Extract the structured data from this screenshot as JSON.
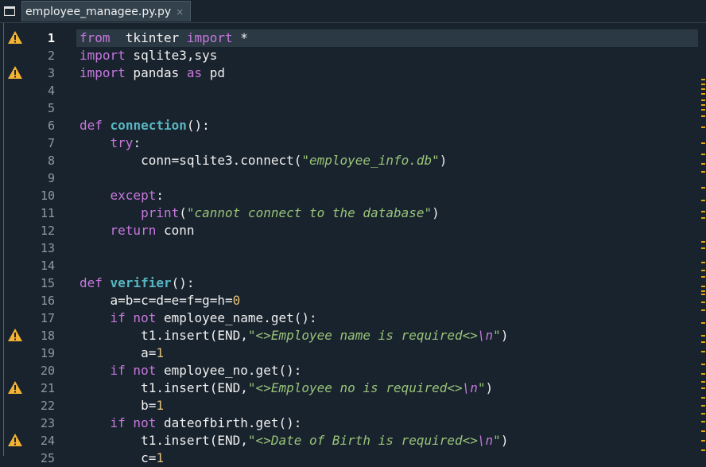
{
  "tab": {
    "label": "employee_managee.py.py",
    "close": "×"
  },
  "icons": {
    "tab_menu": "window-icon",
    "warning": "warning-icon"
  },
  "colors": {
    "warning": "#f2b233",
    "accent": "#1a72bb"
  },
  "current_line": 1,
  "lines": [
    {
      "n": "1",
      "warn": true,
      "tokens": [
        [
          "kw",
          "from"
        ],
        [
          "",
          "  tkinter "
        ],
        [
          "kw",
          "import"
        ],
        [
          "",
          " *"
        ]
      ]
    },
    {
      "n": "2",
      "warn": false,
      "tokens": [
        [
          "kw",
          "import"
        ],
        [
          "",
          " sqlite3,sys"
        ]
      ]
    },
    {
      "n": "3",
      "warn": true,
      "tokens": [
        [
          "kw",
          "import"
        ],
        [
          "",
          " pandas "
        ],
        [
          "kw",
          "as"
        ],
        [
          "",
          " pd"
        ]
      ]
    },
    {
      "n": "4",
      "warn": false,
      "tokens": []
    },
    {
      "n": "5",
      "warn": false,
      "tokens": []
    },
    {
      "n": "6",
      "warn": false,
      "tokens": [
        [
          "kw",
          "def"
        ],
        [
          "",
          " "
        ],
        [
          "fn",
          "connection"
        ],
        [
          "",
          "():"
        ]
      ]
    },
    {
      "n": "7",
      "warn": false,
      "tokens": [
        [
          "",
          "    "
        ],
        [
          "kw",
          "try"
        ],
        [
          "",
          ":"
        ]
      ]
    },
    {
      "n": "8",
      "warn": false,
      "tokens": [
        [
          "",
          "        conn=sqlite3.connect("
        ],
        [
          "str",
          "\"employee_info.db\""
        ],
        [
          "",
          ")"
        ]
      ]
    },
    {
      "n": "9",
      "warn": false,
      "tokens": []
    },
    {
      "n": "10",
      "warn": false,
      "tokens": [
        [
          "",
          "    "
        ],
        [
          "kw",
          "except"
        ],
        [
          "",
          ":"
        ]
      ]
    },
    {
      "n": "11",
      "warn": false,
      "tokens": [
        [
          "",
          "        "
        ],
        [
          "bi",
          "print"
        ],
        [
          "",
          "("
        ],
        [
          "str",
          "\"cannot connect to the database\""
        ],
        [
          "",
          ")"
        ]
      ]
    },
    {
      "n": "12",
      "warn": false,
      "tokens": [
        [
          "",
          "    "
        ],
        [
          "kw",
          "return"
        ],
        [
          "",
          " conn"
        ]
      ]
    },
    {
      "n": "13",
      "warn": false,
      "tokens": []
    },
    {
      "n": "14",
      "warn": false,
      "tokens": []
    },
    {
      "n": "15",
      "warn": false,
      "tokens": [
        [
          "kw",
          "def"
        ],
        [
          "",
          " "
        ],
        [
          "fn",
          "verifier"
        ],
        [
          "",
          "():"
        ]
      ]
    },
    {
      "n": "16",
      "warn": false,
      "tokens": [
        [
          "",
          "    a=b=c=d=e=f=g=h="
        ],
        [
          "num",
          "0"
        ]
      ]
    },
    {
      "n": "17",
      "warn": false,
      "tokens": [
        [
          "",
          "    "
        ],
        [
          "kw",
          "if not"
        ],
        [
          "",
          " employee_name.get():"
        ]
      ]
    },
    {
      "n": "18",
      "warn": true,
      "tokens": [
        [
          "",
          "        t1.insert(END,"
        ],
        [
          "str",
          "\"<>Employee name is required<>"
        ],
        [
          "esc",
          "\\n"
        ],
        [
          "str",
          "\""
        ],
        [
          "",
          ")"
        ]
      ]
    },
    {
      "n": "19",
      "warn": false,
      "tokens": [
        [
          "",
          "        a="
        ],
        [
          "num",
          "1"
        ]
      ]
    },
    {
      "n": "20",
      "warn": false,
      "tokens": [
        [
          "",
          "    "
        ],
        [
          "kw",
          "if not"
        ],
        [
          "",
          " employee_no.get():"
        ]
      ]
    },
    {
      "n": "21",
      "warn": true,
      "tokens": [
        [
          "",
          "        t1.insert(END,"
        ],
        [
          "str",
          "\"<>Employee no is required<>"
        ],
        [
          "esc",
          "\\n"
        ],
        [
          "str",
          "\""
        ],
        [
          "",
          ")"
        ]
      ]
    },
    {
      "n": "22",
      "warn": false,
      "tokens": [
        [
          "",
          "        b="
        ],
        [
          "num",
          "1"
        ]
      ]
    },
    {
      "n": "23",
      "warn": false,
      "tokens": [
        [
          "",
          "    "
        ],
        [
          "kw",
          "if not"
        ],
        [
          "",
          " dateofbirth.get():"
        ]
      ]
    },
    {
      "n": "24",
      "warn": true,
      "tokens": [
        [
          "",
          "        t1.insert(END,"
        ],
        [
          "str",
          "\"<>Date of Birth is required<>"
        ],
        [
          "esc",
          "\\n"
        ],
        [
          "str",
          "\""
        ],
        [
          "",
          ")"
        ]
      ]
    },
    {
      "n": "25",
      "warn": false,
      "tokens": [
        [
          "",
          "        c="
        ],
        [
          "num",
          "1"
        ]
      ]
    }
  ]
}
